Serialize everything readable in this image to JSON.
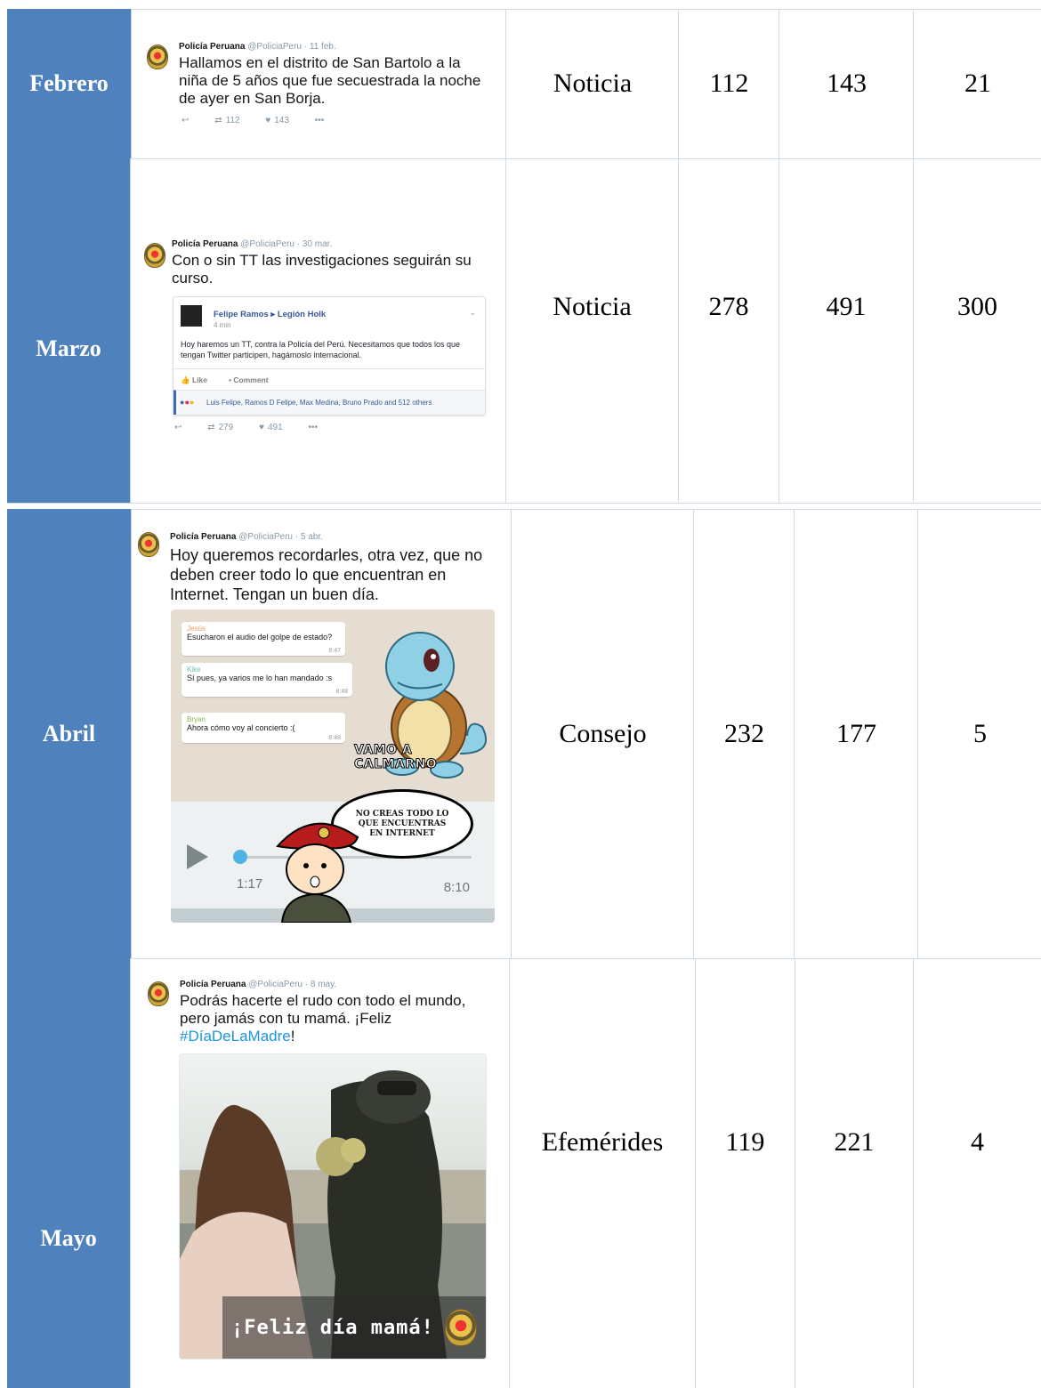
{
  "rows": [
    {
      "month": "Febrero",
      "tweet": {
        "name": "Policía Peruana",
        "handle": "@PoliciaPeru · 11 feb.",
        "text": "Hallamos en el distrito de San Bartolo a la niña de 5 años que fue secuestrada la noche de ayer en San Borja.",
        "retweets": "112",
        "likes": "143"
      },
      "type": "Noticia",
      "v1": "112",
      "v2": "143",
      "v3": "21"
    },
    {
      "month": "Marzo",
      "tweet": {
        "name": "Policía Peruana",
        "handle": "@PoliciaPeru · 30 mar.",
        "text": "Con o sin TT las investigaciones seguirán su curso.",
        "retweets": "279",
        "likes": "491",
        "fb": {
          "author": "Felipe Ramos ▸ Legión Holk",
          "time": "4 min",
          "text": "Hoy haremos un TT, contra la Policía del Perú. Necesitamos que todos los que tengan Twitter participen, hagámoslo internacional.",
          "like": "Like",
          "comment": "Comment",
          "reactions": "Luis Felipe, Ramos D Felipe, Max Medina, Bruno Prado and 512 others"
        }
      },
      "type": "Noticia",
      "v1": "278",
      "v2": "491",
      "v3": "300"
    },
    {
      "month": "Abril",
      "tweet": {
        "name": "Policía Peruana",
        "handle": "@PoliciaPeru · 5 abr.",
        "text": "Hoy queremos recordarles, otra vez, que no deben creer todo lo que encuentran en Internet. Tengan un buen día.",
        "chat": [
          {
            "sender": "Jesús",
            "msg": "Esucharon el audio del golpe de estado?",
            "time": "8:47",
            "color": "#e9a05c"
          },
          {
            "sender": "Kike",
            "msg": "Sí pues, ya varios me lo han mandado :s",
            "time": "8:48",
            "color": "#5cc8a2"
          },
          {
            "sender": "Bryan",
            "msg": "Ahora cómo voy al concierto :(",
            "time": "8:48",
            "color": "#7fb24a"
          }
        ],
        "meme_caption": "VAMO A CALMARNO",
        "speech": "NO CREAS TODO LO QUE ENCUENTRAS EN INTERNET",
        "audio_elapsed": "1:17",
        "audio_total": "8:10"
      },
      "type": "Consejo",
      "v1": "232",
      "v2": "177",
      "v3": "5"
    },
    {
      "month": "Mayo",
      "tweet": {
        "name": "Policía Peruana",
        "handle": "@PoliciaPeru · 8 may.",
        "text_pre": "Podrás hacerte el rudo con todo el mundo, pero jamás con tu mamá. ¡Feliz ",
        "hashtag": "#DíaDeLaMadre",
        "text_post": "!",
        "photo_caption": "¡Feliz día mamá!"
      },
      "type": "Efemérides",
      "v1": "119",
      "v2": "221",
      "v3": "4"
    }
  ],
  "icons": {
    "reply": "↩",
    "retweet": "⇄",
    "like": "♥",
    "more": "•••"
  },
  "colors": {
    "month_bg": "#4f81bd",
    "grid": "#cfd9e8"
  }
}
